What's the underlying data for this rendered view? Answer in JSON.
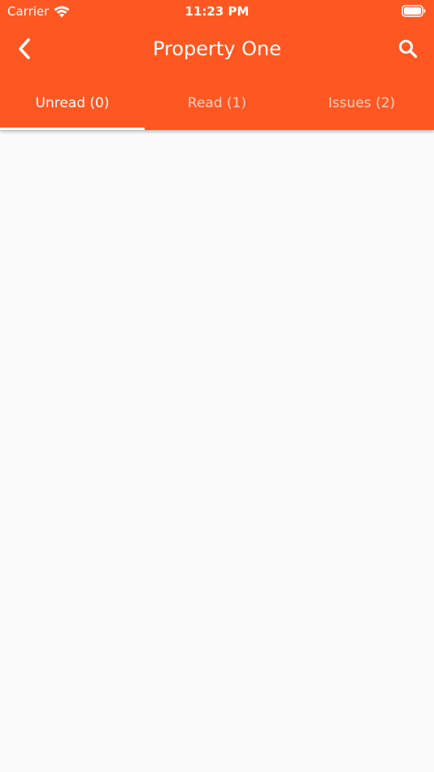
{
  "status_bar": {
    "carrier": "Carrier",
    "time": "11:23 PM"
  },
  "app_bar": {
    "title": "Property One",
    "color": "#ff5722",
    "back_icon": "chevron-left-icon",
    "search_icon": "search-icon"
  },
  "tabs": [
    {
      "label": "Unread (0)",
      "active": true
    },
    {
      "label": "Read (1)",
      "active": false
    },
    {
      "label": "Issues (2)",
      "active": false
    }
  ],
  "content": {
    "background": "#fafafa"
  }
}
